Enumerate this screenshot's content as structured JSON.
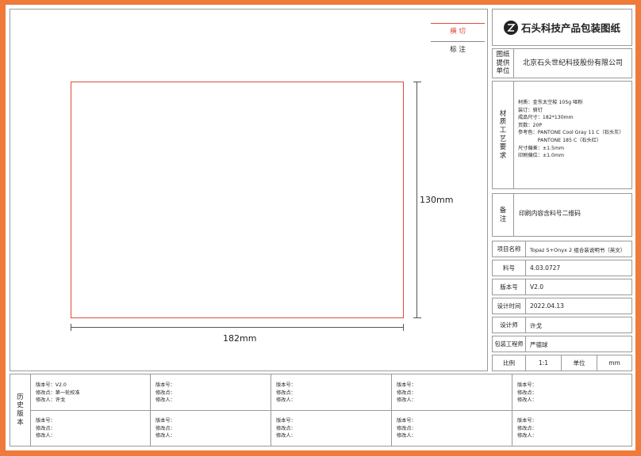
{
  "legend": {
    "cut": "横 切",
    "note": "标 注"
  },
  "drawing": {
    "height_label": "130mm",
    "width_label": "182mm",
    "outline_color": "#e04a3a"
  },
  "title_block": {
    "company_title": "石头科技产品包装图纸",
    "provider_label": "图纸\n提供\n单位",
    "provider_value": "北京石头世纪科技股份有限公司",
    "material_label": "材\n质\n工\n艺\n要\n求",
    "material_lines": [
      "材质：金东太空梭 105g 哑粉",
      "装订：骑钉",
      "成品尺寸：182*130mm",
      "页数：20P",
      "参考色：PANTONE Cool Gray 11 C（石头灰）",
      "　　　　PANTONE 185 C（石头红）",
      "尺寸偏差：±1.5mm",
      "印刷偏位：±1.0mm"
    ],
    "remark_label": "备\n注",
    "remark_value": "印刷内容含料号二维码",
    "rows": [
      {
        "label": "项目名称",
        "value": "Topaz S+Onyx 2 组合装说明书（英文）"
      },
      {
        "label": "料号",
        "value": "4.03.0727"
      },
      {
        "label": "版本号",
        "value": "V2.0"
      },
      {
        "label": "设计时间",
        "value": "2022.04.13"
      },
      {
        "label": "设计师",
        "value": "许戈"
      },
      {
        "label": "包装工程师",
        "value": "严德球"
      }
    ],
    "scale_label": "比例",
    "scale_value": "1:1",
    "unit_label": "单位",
    "unit_value": "mm"
  },
  "history": {
    "label": "历\n史\n版\n本",
    "cells": [
      [
        "版本号：V2.0",
        "修改点：第一轮校准",
        "修改人：许戈"
      ],
      [
        "版本号：",
        "修改点：",
        "修改人："
      ],
      [
        "版本号：",
        "修改点：",
        "修改人："
      ],
      [
        "版本号：",
        "修改点：",
        "修改人："
      ],
      [
        "版本号：",
        "修改点：",
        "修改人："
      ],
      [
        "版本号：",
        "修改点：",
        "修改人："
      ],
      [
        "版本号：",
        "修改点：",
        "修改人："
      ],
      [
        "版本号：",
        "修改点：",
        "修改人："
      ],
      [
        "版本号：",
        "修改点：",
        "修改人："
      ],
      [
        "版本号：",
        "修改点：",
        "修改人："
      ]
    ]
  },
  "colors": {
    "border": "#ef7a3a",
    "red": "#e04a3a"
  }
}
